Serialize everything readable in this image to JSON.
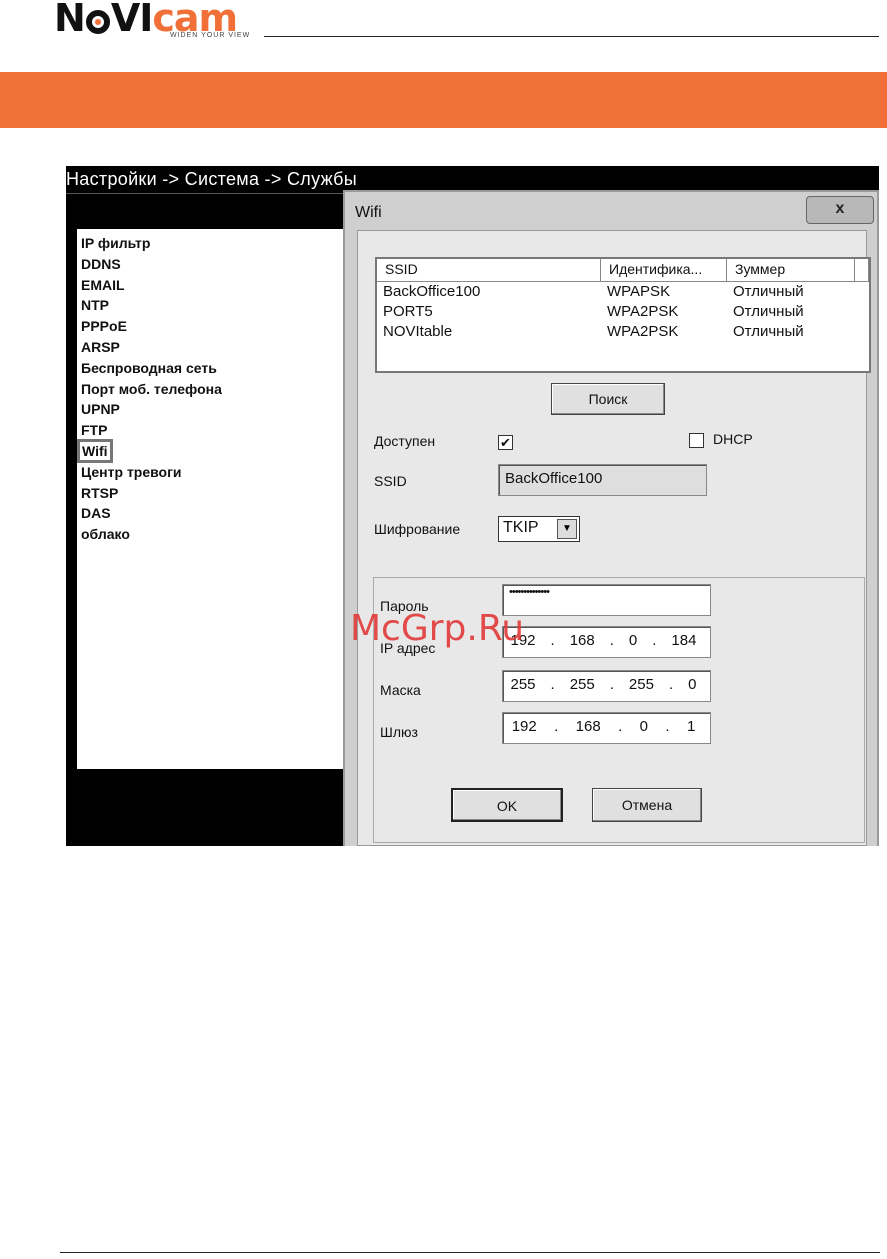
{
  "header": {
    "logo_prefix": "N",
    "logo_mid": "VI",
    "logo_suffix": "cam",
    "logo_tagline": "WIDEN YOUR VIEW"
  },
  "screen": {
    "breadcrumb": "Настройки -> Система -> Службы",
    "menu_items": [
      "IP фильтр",
      "DDNS",
      "EMAIL",
      "NTP",
      "PPPoE",
      "ARSP",
      "Беспроводная сеть",
      "Порт моб. телефона",
      "UPNP",
      "FTP",
      "Wifi",
      "Центр тревоги",
      "RTSP",
      "DAS",
      "облако"
    ],
    "selected_item": "Wifi"
  },
  "dialog": {
    "title": "Wifi",
    "close_glyph": "x",
    "columns": [
      "SSID",
      "Идентифика...",
      "Зуммер",
      ""
    ],
    "networks": [
      {
        "ssid": "BackOffice100",
        "auth": "WPAPSK",
        "signal": "Отличный"
      },
      {
        "ssid": "PORT5",
        "auth": "WPA2PSK",
        "signal": "Отличный"
      },
      {
        "ssid": "NOVItable",
        "auth": "WPA2PSK",
        "signal": "Отличный"
      }
    ],
    "search_label": "Поиск",
    "enabled_label": "Доступен",
    "enabled_mark": "✔",
    "dhcp_label": "DHCP",
    "ssid_label": "SSID",
    "ssid_value": "BackOffice100",
    "encryption_label": "Шифрование",
    "encryption_value": "TKIP",
    "password_label": "Пароль",
    "password_value": "••••••••••••••",
    "ip_label": "IP адрес",
    "ip_value": [
      "192",
      "168",
      "0",
      "184"
    ],
    "mask_label": "Маска",
    "mask_value": [
      "255",
      "255",
      "255",
      "0"
    ],
    "gateway_label": "Шлюз",
    "gateway_value": [
      "192",
      "168",
      "0",
      "1"
    ],
    "ok_label": "OK",
    "cancel_label": "Отмена"
  },
  "watermark": "McGrp.Ru",
  "colors": {
    "accent": "#f07038"
  }
}
